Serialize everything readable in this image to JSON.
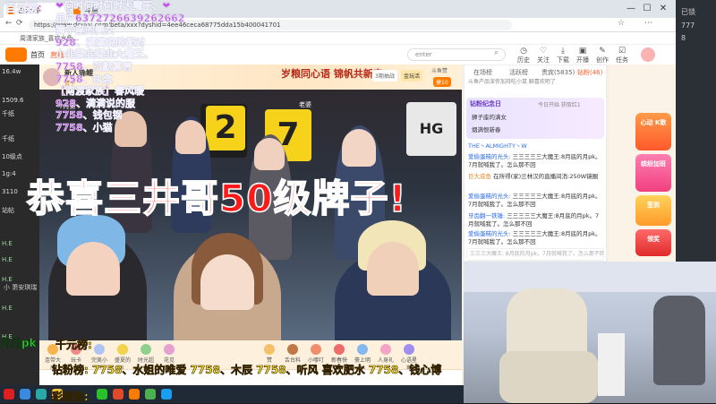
{
  "browser": {
    "tabs": [
      "百元榜",
      "斗鱼",
      "周潇家族_喜欢水色"
    ],
    "url": "https://www.douyu.com/beta/xxx?dyshid=4ee46ceca68775dda15b400041701",
    "bookmark": "周潇家族_喜欢水色..."
  },
  "header": {
    "nav_home": "首页",
    "nav_live": "直播",
    "search_placeholder": "enter",
    "icons": [
      {
        "icon": "history-icon",
        "label": "历史"
      },
      {
        "icon": "follow-icon",
        "label": "关注"
      },
      {
        "icon": "download-icon",
        "label": "下载"
      },
      {
        "icon": "open-icon",
        "label": "开播"
      },
      {
        "icon": "creator-icon",
        "label": "创作"
      },
      {
        "icon": "task-icon",
        "label": "任务"
      }
    ]
  },
  "left_nav": {
    "items": [
      "16.4w",
      "1509.6",
      "千纸",
      "千纸",
      "10级点",
      "1g:4",
      "3110",
      "站帖",
      "H.E",
      "H.E",
      "H.E",
      "H.E",
      "H.E",
      "小 萧安琪瑞"
    ]
  },
  "anchor": {
    "name": "新人锦鲤",
    "badge": "赞十",
    "banner": "岁粮同心语 锦帆共新春",
    "btn_rank": "3期抽战",
    "btn_gold": "金玩活",
    "btn_follow": "斗鱼赞",
    "btn_count": "捷10"
  },
  "player": {
    "poster_left": "7",
    "poster_mid": "2",
    "poster_text": "HG",
    "sign": "老婆",
    "month_tag": "7月第"
  },
  "gifts": [
    {
      "label": "连带大厅"
    },
    {
      "label": "玩卡"
    },
    {
      "label": "完美小白"
    },
    {
      "label": "盛夏的礼"
    },
    {
      "label": "时光超市"
    },
    {
      "label": "花见"
    },
    {
      "label": "赞"
    },
    {
      "label": "舌台料"
    },
    {
      "label": "小嗲叮"
    },
    {
      "label": "新春快乐"
    },
    {
      "label": "豪上明林"
    },
    {
      "label": "人身礼子"
    },
    {
      "label": "心语星期"
    }
  ],
  "chat": {
    "tabs": [
      "在场榜",
      "活跃榜",
      "贵宾(5835)",
      "钻粉(46)"
    ],
    "notice": "斗鱼产品深伴加持吃小鼠 聊喜欢吧了",
    "fans_title": "钻粉纪念日",
    "fans_sub": "今日开始 获取红1",
    "messages": [
      {
        "user": "狮子座的满女",
        "text": ""
      },
      {
        "user": "烟满恨新春",
        "text": ""
      },
      {
        "user": "THE丶ALMIGHTY丶W",
        "text": ""
      },
      {
        "user": "爱偷蛋糕的光头:",
        "text": "三三三三三大魔王:8月底的月pk。7月就喊我了。怎么那不回"
      },
      {
        "user": "巨大成鱼",
        "text": "在所得(家)兰林汉的直播间消:250W镜圈"
      },
      {
        "user": "爱偷蛋糕的光头:",
        "text": "三三三三三大魔王:8月底的月pk。7月就喊我了。怎么那不回"
      },
      {
        "user": "牙齿翻一铁锤:",
        "text": "三三三三三大魔王:8月底的月pk。7月就喊我了。怎么那不回"
      },
      {
        "user": "爱偷蛋糕的光头:",
        "text": "三三三三三大魔王:8月底的月pk。7月就喊我了。怎么那不回"
      }
    ],
    "input_placeholder": "三三三大魔王: 8月底的月pk。7月就喊我了。怎么那不回"
  },
  "right_ads": [
    {
      "title": "心动 K歌"
    },
    {
      "title": "缤纷加班"
    },
    {
      "title": "签到"
    },
    {
      "title": "领奖"
    }
  ],
  "overlay": {
    "title": "百元榜:",
    "rank_lines": [
      "❤何时何时何时大魔王、❤",
      "用户6372726639262662",
      "狮子座的美女",
      "928、满满说的都对",
      "小韭菜韭菜韭大魔王、",
      "7758、沉默寡言",
      "7758、执念",
      "【南渡家族】春风暖",
      "928、满满说的服",
      "7758、钱包钢",
      "7758、小猫"
    ],
    "big_message": "恭喜三井哥50级牌子!",
    "bottom_left": "月月pk",
    "bottom_label1": "千元榜:",
    "diamond_line": "钻粉榜: 7758、水姐的唯爱 7758、木辰 7758、听风 喜欢肥水 7758、钱心博",
    "egg_group": "彩蛋组:"
  },
  "far_right": {
    "labels": [
      "已锁",
      "777",
      "8"
    ]
  },
  "taskbar": {
    "icons": [
      "start-icon",
      "search-icon",
      "task-view-icon",
      "file-icon",
      "wechat-icon",
      "store-icon",
      "douyu-icon",
      "chrome-icon",
      "qq-icon"
    ]
  },
  "colors": {
    "overlay_purple": "#c050e8",
    "overlay_red": "#ff1a1a",
    "overlay_green": "#2ad62a",
    "overlay_yellow": "#ffe52a",
    "douyu_orange": "#ff7a00"
  }
}
